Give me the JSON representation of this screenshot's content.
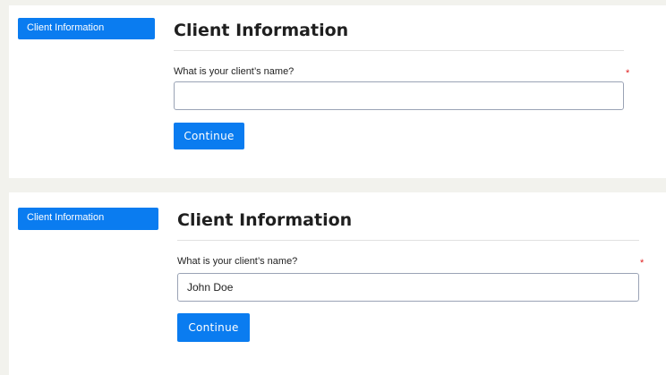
{
  "panels": [
    {
      "nav_item": "Client Information",
      "title": "Client Information",
      "question": "What is your client’s name?",
      "required_mark": "*",
      "input_value": "",
      "button_label": "Continue"
    },
    {
      "nav_item": "Client Information",
      "title": "Client Information",
      "question": "What is your client’s name?",
      "required_mark": "*",
      "input_value": "John Doe",
      "button_label": "Continue"
    }
  ],
  "colors": {
    "primary": "#0a7cf0",
    "required": "#e02020",
    "background": "#f2f2ed"
  }
}
